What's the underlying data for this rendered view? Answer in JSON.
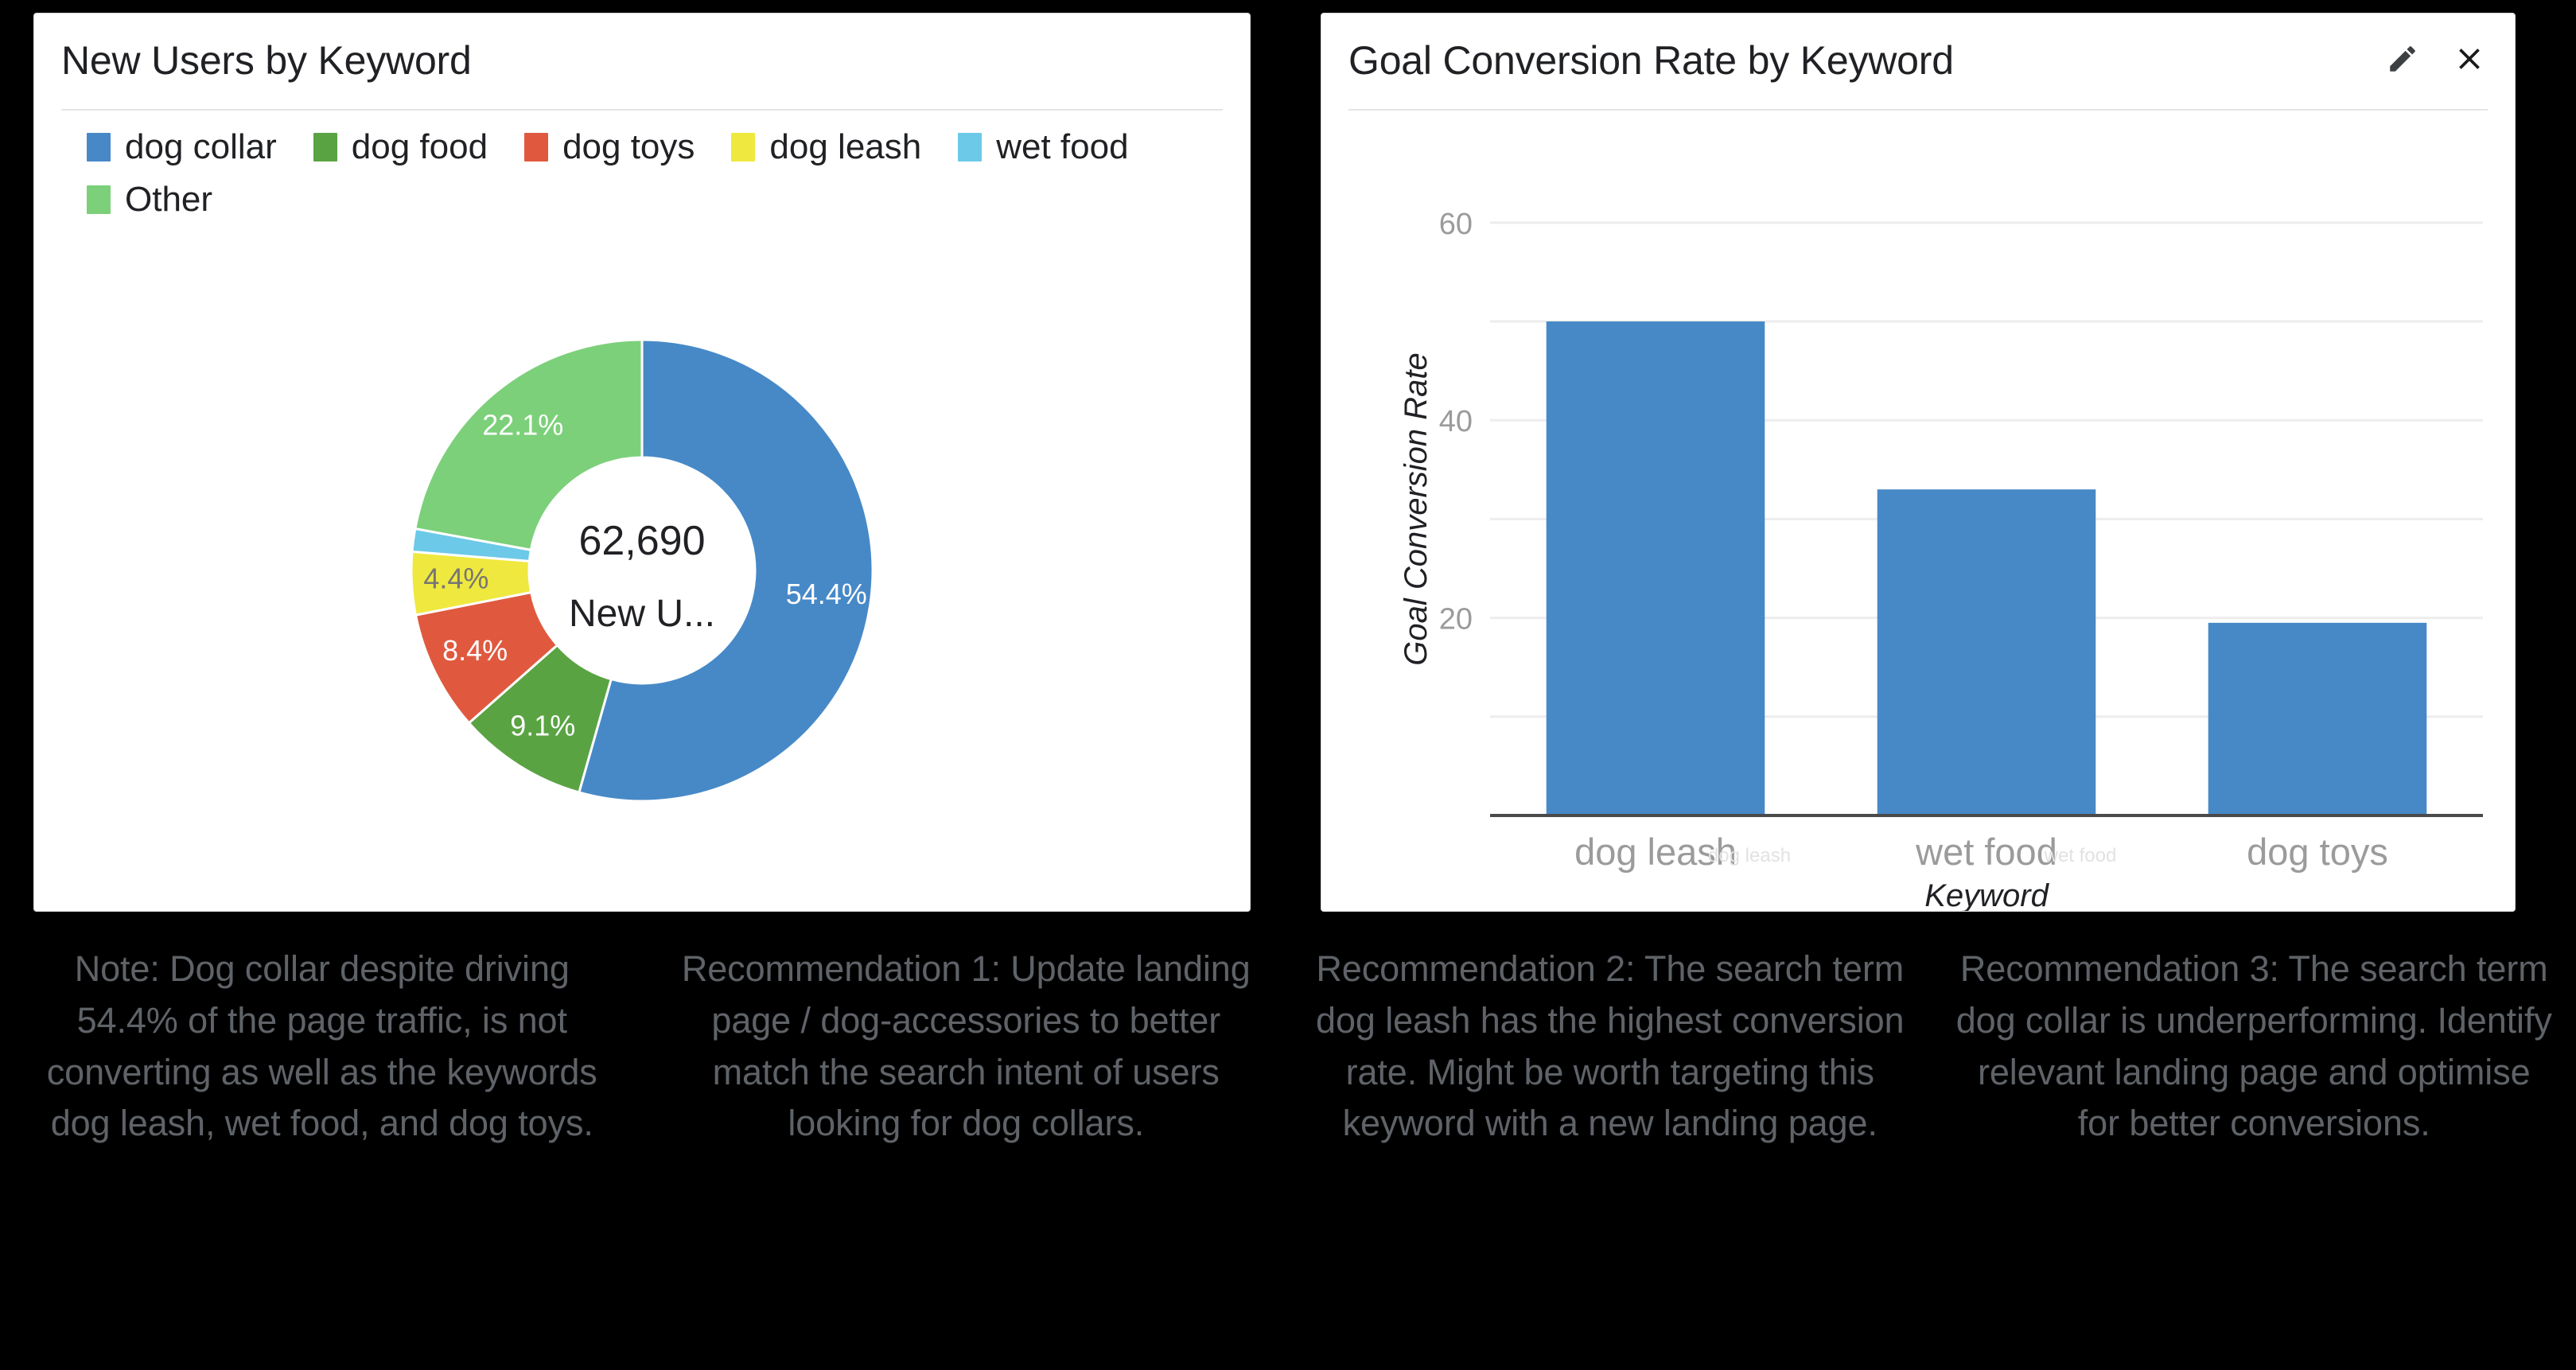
{
  "left_card": {
    "title": "New Users by Keyword",
    "legend": [
      {
        "label": "dog collar",
        "color": "#4789c7"
      },
      {
        "label": "dog food",
        "color": "#5aa343"
      },
      {
        "label": "dog toys",
        "color": "#e0593f"
      },
      {
        "label": "dog leash",
        "color": "#efe83f"
      },
      {
        "label": "wet food",
        "color": "#6cc9e8"
      },
      {
        "label": "Other",
        "color": "#7cd07a"
      }
    ],
    "center_value": "62,690",
    "center_label": "New U..."
  },
  "right_card": {
    "title": "Goal Conversion Rate by Keyword",
    "edit_icon": "pencil-icon",
    "close_icon": "close-icon"
  },
  "notes": [
    "Note: Dog collar despite driving 54.4% of the page traffic, is not converting as well as the keywords dog leash, wet food, and dog toys.",
    "Recommendation 1: Update landing page / dog-accessories to better match the search intent of users looking for dog collars.",
    "Recommendation 2: The search term dog leash has the highest conversion rate. Might be worth targeting this keyword with a new landing page.",
    "Recommendation 3: The search term dog collar is underperforming. Identify relevant landing page and optimise for better conversions."
  ],
  "chart_data": [
    {
      "type": "pie",
      "variant": "donut",
      "title": "New Users by Keyword",
      "center_value": "62,690",
      "center_label": "New U...",
      "total": 62690,
      "unit": "%",
      "legend_position": "top",
      "labels": [
        "dog collar",
        "dog food",
        "dog toys",
        "dog leash",
        "wet food",
        "Other"
      ],
      "values": [
        54.4,
        9.1,
        8.4,
        4.4,
        1.6,
        22.1
      ],
      "data_labels": [
        "54.4%",
        "9.1%",
        "8.4%",
        "4.4%",
        "",
        "22.1%"
      ],
      "colors": [
        "#4789c7",
        "#5aa343",
        "#e0593f",
        "#efe83f",
        "#6cc9e8",
        "#7cd07a"
      ],
      "start_angle_deg": 0,
      "direction": "clockwise"
    },
    {
      "type": "bar",
      "title": "Goal Conversion Rate by Keyword",
      "xlabel": "Keyword",
      "ylabel": "Goal Conversion Rate",
      "categories": [
        "dog leash",
        "wet food",
        "dog toys"
      ],
      "values": [
        50,
        33,
        19.5
      ],
      "series": [
        {
          "name": "Goal Conversion Rate",
          "values": [
            50,
            33,
            19.5
          ]
        }
      ],
      "ylim": [
        0,
        62
      ],
      "yticks": [
        20,
        40,
        60
      ],
      "ytick_labels": [
        "20",
        "40",
        "60"
      ],
      "gridlines": [
        10,
        20,
        30,
        40,
        50,
        60
      ],
      "grid": true,
      "legend_position": "none",
      "bar_color": "#4789c7"
    }
  ]
}
